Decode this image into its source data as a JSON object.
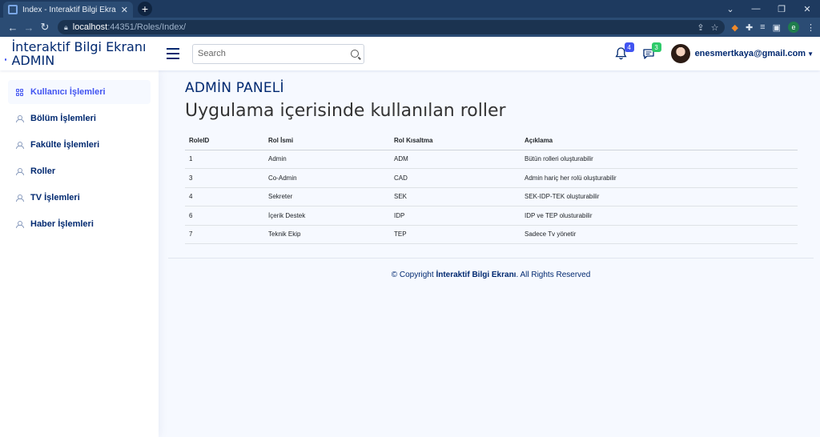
{
  "browser": {
    "tab_title": "Index - İnteraktif Bilgi Ekranı Admi",
    "tab_close": "✕",
    "new_tab": "+",
    "url_host": "localhost",
    "url_path": ":44351/Roles/Index/",
    "window_controls": [
      "⌄",
      "—",
      "❐",
      "✕"
    ],
    "profile_letter": "e"
  },
  "header": {
    "brand": "İnteraktif Bilgi Ekranı ADMIN",
    "search_placeholder": "Search",
    "notifications_count": "4",
    "messages_count": "3",
    "user_email": "enesmertkaya@gmail.com"
  },
  "sidebar": {
    "items": [
      {
        "label": "Kullanıcı İşlemleri",
        "icon": "grid-icon",
        "active": true
      },
      {
        "label": "Bölüm İşlemleri",
        "icon": "person-icon",
        "active": false
      },
      {
        "label": "Fakülte İşlemleri",
        "icon": "person-icon",
        "active": false
      },
      {
        "label": "Roller",
        "icon": "person-icon",
        "active": false
      },
      {
        "label": "TV İşlemleri",
        "icon": "person-icon",
        "active": false
      },
      {
        "label": "Haber İşlemleri",
        "icon": "person-icon",
        "active": false
      }
    ]
  },
  "main": {
    "page_title": "ADMİN PANELİ",
    "heading": "Uygulama içerisinde kullanılan roller",
    "table": {
      "columns": [
        "RoleID",
        "Rol İsmi",
        "Rol Kısaltma",
        "Açıklama"
      ],
      "rows": [
        [
          "1",
          "Admin",
          "ADM",
          "Bütün rolleri oluşturabilir"
        ],
        [
          "3",
          "Co-Admin",
          "CAD",
          "Admin hariç her rolü oluşturabilir"
        ],
        [
          "4",
          "Sekreter",
          "SEK",
          "SEK-IDP-TEK oluşturabilir"
        ],
        [
          "6",
          "İçerik Destek",
          "IDP",
          "IDP ve TEP olusturabilir"
        ],
        [
          "7",
          "Teknik Ekip",
          "TEP",
          "Sadece Tv yönetir"
        ]
      ]
    }
  },
  "footer": {
    "prefix": "© Copyright ",
    "brand": "İnteraktif Bilgi Ekranı",
    "suffix": ". All Rights Reserved"
  }
}
